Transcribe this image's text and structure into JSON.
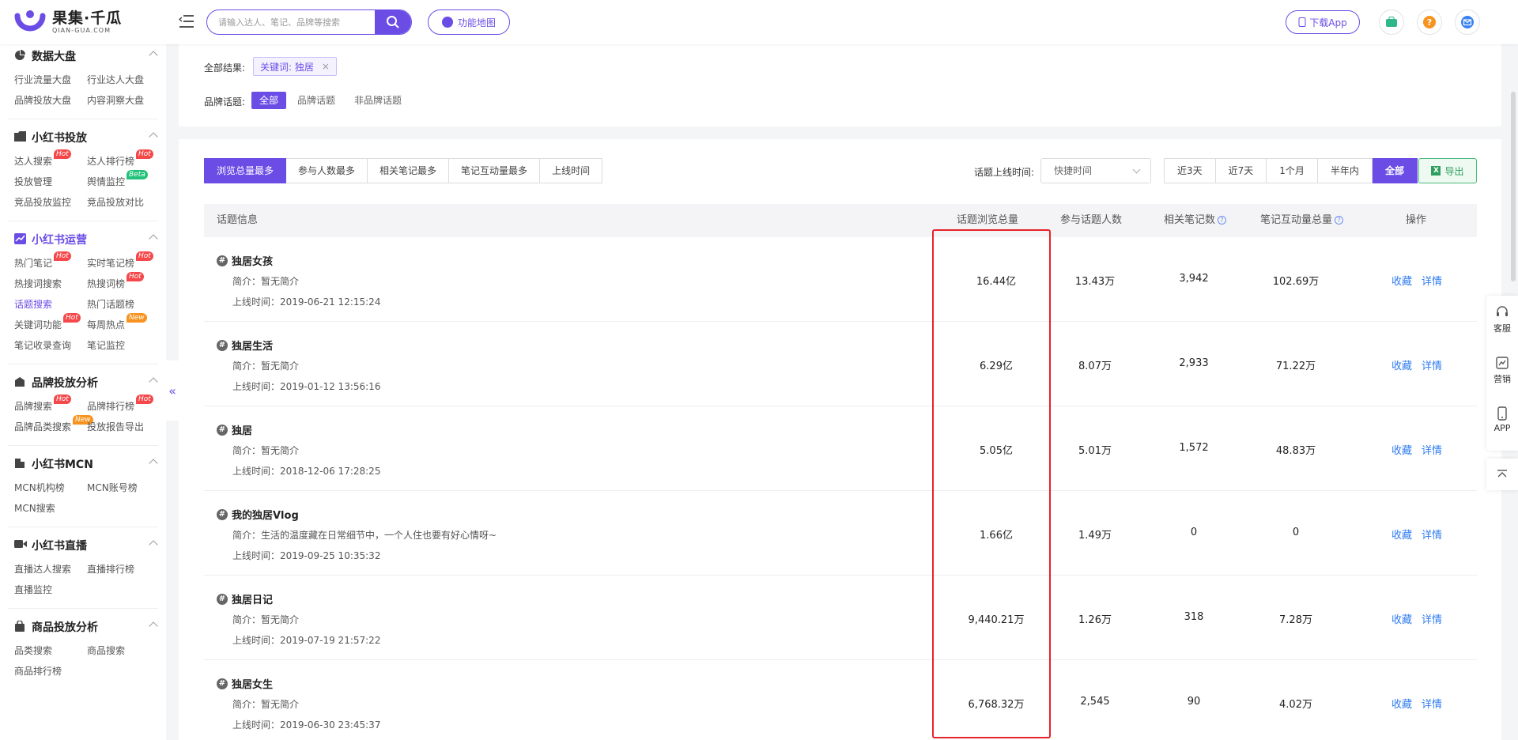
{
  "brand": {
    "name_cn": "果集·千瓜",
    "name_en": "QIAN-GUA.COM",
    "color": "#6b4de6"
  },
  "search": {
    "placeholder": "请输入达人、笔记、品牌等搜索"
  },
  "header": {
    "func_map": "功能地图",
    "download_app": "下载App"
  },
  "sidebar": {
    "sections": [
      {
        "title": "数据大盘",
        "items": [
          "行业流量大盘",
          "行业达人大盘",
          "品牌投放大盘",
          "内容洞察大盘"
        ]
      },
      {
        "title": "小红书投放",
        "items": [
          "达人搜索",
          "达人排行榜",
          "投放管理",
          "舆情监控",
          "竞品投放监控",
          "竞品投放对比"
        ]
      },
      {
        "title": "小红书运营",
        "items": [
          "热门笔记",
          "实时笔记榜",
          "热搜词搜索",
          "热搜词榜",
          "话题搜索",
          "热门话题榜",
          "关键词功能",
          "每周热点",
          "笔记收录查询",
          "笔记监控"
        ]
      },
      {
        "title": "品牌投放分析",
        "items": [
          "品牌搜索",
          "品牌排行榜",
          "品牌品类搜索",
          "投放报告导出"
        ]
      },
      {
        "title": "小红书MCN",
        "items": [
          "MCN机构榜",
          "MCN账号榜",
          "MCN搜索"
        ]
      },
      {
        "title": "小红书直播",
        "items": [
          "直播达人搜索",
          "直播排行榜",
          "直播监控"
        ]
      },
      {
        "title": "商品投放分析",
        "items": [
          "品类搜索",
          "商品搜索",
          "商品排行榜"
        ]
      }
    ],
    "badges": {
      "hot": "Hot",
      "new": "New",
      "beta": "Beta"
    }
  },
  "filters": {
    "all_results_label": "全部结果:",
    "keyword_chip": "关键词: 独居",
    "chip_close": "×",
    "brand_topic_label": "品牌话题:",
    "brand_topic_options": [
      "全部",
      "品牌话题",
      "非品牌话题"
    ]
  },
  "sort": {
    "options": [
      "浏览总量最多",
      "参与人数最多",
      "相关笔记最多",
      "笔记互动量最多",
      "上线时间"
    ]
  },
  "time_filter": {
    "label": "话题上线时间:",
    "select_value": "快捷时间",
    "ranges": [
      "近3天",
      "近7天",
      "1个月",
      "半年内",
      "全部"
    ],
    "export": "导出"
  },
  "table": {
    "headers": {
      "info": "话题信息",
      "views": "话题浏览总量",
      "participants": "参与话题人数",
      "notes": "相关笔记数",
      "interactions": "笔记互动量总量",
      "ops": "操作"
    },
    "rows": [
      {
        "name": "独居女孩",
        "intro": "简介：暂无简介",
        "time": "上线时间：2019-06-21 12:15:24",
        "views": "16.44亿",
        "participants": "13.43万",
        "notes": "3,942",
        "interactions": "102.69万"
      },
      {
        "name": "独居生活",
        "intro": "简介：暂无简介",
        "time": "上线时间：2019-01-12 13:56:16",
        "views": "6.29亿",
        "participants": "8.07万",
        "notes": "2,933",
        "interactions": "71.22万"
      },
      {
        "name": "独居",
        "intro": "简介：暂无简介",
        "time": "上线时间：2018-12-06 17:28:25",
        "views": "5.05亿",
        "participants": "5.01万",
        "notes": "1,572",
        "interactions": "48.83万"
      },
      {
        "name": "我的独居Vlog",
        "intro": "简介：生活的温度藏在日常细节中，一个人住也要有好心情呀~",
        "time": "上线时间：2019-09-25 10:35:32",
        "views": "1.66亿",
        "participants": "1.49万",
        "notes": "0",
        "interactions": "0"
      },
      {
        "name": "独居日记",
        "intro": "简介：暂无简介",
        "time": "上线时间：2019-07-19 21:57:22",
        "views": "9,440.21万",
        "participants": "1.26万",
        "notes": "318",
        "interactions": "7.28万"
      },
      {
        "name": "独居女生",
        "intro": "简介：暂无简介",
        "time": "上线时间：2019-06-30 23:45:37",
        "views": "6,768.32万",
        "participants": "2,545",
        "notes": "90",
        "interactions": "4.02万"
      }
    ],
    "actions": {
      "collect": "收藏",
      "detail": "详情"
    }
  },
  "float_bar": {
    "service": "客服",
    "marketing": "营销",
    "app": "APP"
  }
}
